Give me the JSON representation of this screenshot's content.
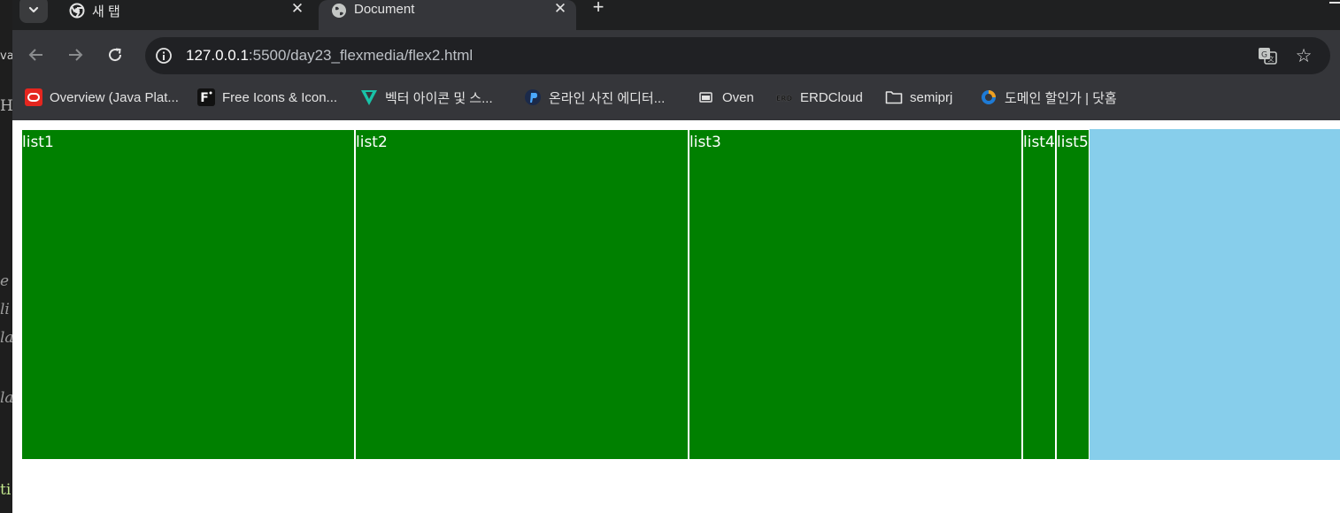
{
  "tabs": [
    {
      "title": "새 탭",
      "active": false,
      "favicon": "chrome-icon"
    },
    {
      "title": "Document",
      "active": true,
      "favicon": "globe-icon"
    }
  ],
  "address_bar": {
    "host": "127.0.0.1",
    "rest": ":5500/day23_flexmedia/flex2.html"
  },
  "bookmarks": [
    {
      "label": "Overview (Java Plat...",
      "icon": "oracle-icon"
    },
    {
      "label": "Free Icons & Icon...",
      "icon": "flaticon-icon"
    },
    {
      "label": "벡터 아이콘 및 스...",
      "icon": "vector-icon"
    },
    {
      "label": "온라인 사진 에디터...",
      "icon": "photo-editor-icon"
    },
    {
      "label": "Oven",
      "icon": "oven-icon"
    },
    {
      "label": "ERDCloud",
      "icon": "erd-icon"
    },
    {
      "label": "semiprj",
      "icon": "folder-icon"
    },
    {
      "label": "도메인 할인가 | 닷홈",
      "icon": "dothome-icon"
    }
  ],
  "page": {
    "items": [
      "list1",
      "list2",
      "list3",
      "list4",
      "list5"
    ]
  },
  "background_editor": {
    "snippets": [
      "va",
      "H",
      "e",
      "li",
      "la",
      "la",
      "ti"
    ]
  },
  "colors": {
    "item_bg": "#008000",
    "container_bg": "#87ceeb"
  }
}
